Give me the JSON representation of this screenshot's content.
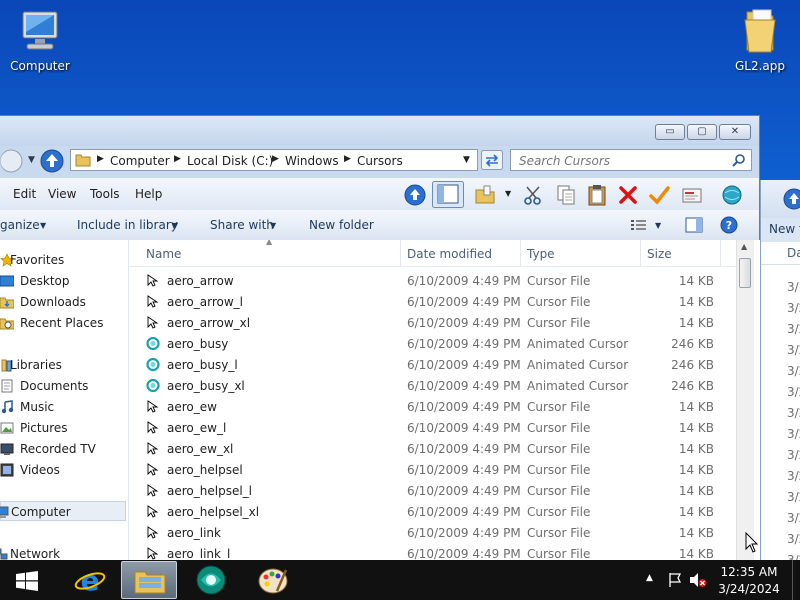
{
  "desktop": {
    "icons": [
      {
        "label": "Computer"
      },
      {
        "label": "GL2.app"
      }
    ]
  },
  "window": {
    "title_buttons": {
      "minimize": "▭",
      "maximize": "▢",
      "close": "✕"
    },
    "address": {
      "crumbs": [
        "Computer",
        "Local Disk (C:)",
        "Windows",
        "Cursors"
      ]
    },
    "search": {
      "placeholder": "Search Cursors"
    },
    "menu": [
      "Edit",
      "View",
      "Tools",
      "Help"
    ],
    "commands": {
      "organize": "ganize",
      "include": "Include in library",
      "share": "Share with",
      "new_folder": "New folder"
    },
    "nav": {
      "favorites": "Favorites",
      "desktop": "Desktop",
      "downloads": "Downloads",
      "recent": "Recent Places",
      "libraries": "Libraries",
      "documents": "Documents",
      "music": "Music",
      "pictures": "Pictures",
      "recorded_tv": "Recorded TV",
      "videos": "Videos",
      "computer": "Computer",
      "network": "Network"
    },
    "columns": {
      "name": "Name",
      "date": "Date modified",
      "type": "Type",
      "size": "Size"
    },
    "files": [
      {
        "name": "aero_arrow",
        "date": "6/10/2009 4:49 PM",
        "type": "Cursor File",
        "size": "14 KB"
      },
      {
        "name": "aero_arrow_l",
        "date": "6/10/2009 4:49 PM",
        "type": "Cursor File",
        "size": "14 KB"
      },
      {
        "name": "aero_arrow_xl",
        "date": "6/10/2009 4:49 PM",
        "type": "Cursor File",
        "size": "14 KB"
      },
      {
        "name": "aero_busy",
        "date": "6/10/2009 4:49 PM",
        "type": "Animated Cursor",
        "size": "246 KB"
      },
      {
        "name": "aero_busy_l",
        "date": "6/10/2009 4:49 PM",
        "type": "Animated Cursor",
        "size": "246 KB"
      },
      {
        "name": "aero_busy_xl",
        "date": "6/10/2009 4:49 PM",
        "type": "Animated Cursor",
        "size": "246 KB"
      },
      {
        "name": "aero_ew",
        "date": "6/10/2009 4:49 PM",
        "type": "Cursor File",
        "size": "14 KB"
      },
      {
        "name": "aero_ew_l",
        "date": "6/10/2009 4:49 PM",
        "type": "Cursor File",
        "size": "14 KB"
      },
      {
        "name": "aero_ew_xl",
        "date": "6/10/2009 4:49 PM",
        "type": "Cursor File",
        "size": "14 KB"
      },
      {
        "name": "aero_helpsel",
        "date": "6/10/2009 4:49 PM",
        "type": "Cursor File",
        "size": "14 KB"
      },
      {
        "name": "aero_helpsel_l",
        "date": "6/10/2009 4:49 PM",
        "type": "Cursor File",
        "size": "14 KB"
      },
      {
        "name": "aero_helpsel_xl",
        "date": "6/10/2009 4:49 PM",
        "type": "Cursor File",
        "size": "14 KB"
      },
      {
        "name": "aero_link",
        "date": "6/10/2009 4:49 PM",
        "type": "Cursor File",
        "size": "14 KB"
      },
      {
        "name": "aero_link_l",
        "date": "6/10/2009 4:49 PM",
        "type": "Cursor File",
        "size": "14 KB"
      }
    ]
  },
  "background_window": {
    "new_folder": "New f",
    "date_header": "Da",
    "dates": [
      "3/",
      "3/2",
      "3/2",
      "3/2",
      "3/2",
      "3/2",
      "3/2",
      "3/2",
      "3/2",
      "3/2",
      "3/2",
      "3/2",
      "3/2",
      "3/2"
    ]
  },
  "taskbar": {
    "clock_time": "12:35 AM",
    "clock_date": "3/24/2024"
  }
}
